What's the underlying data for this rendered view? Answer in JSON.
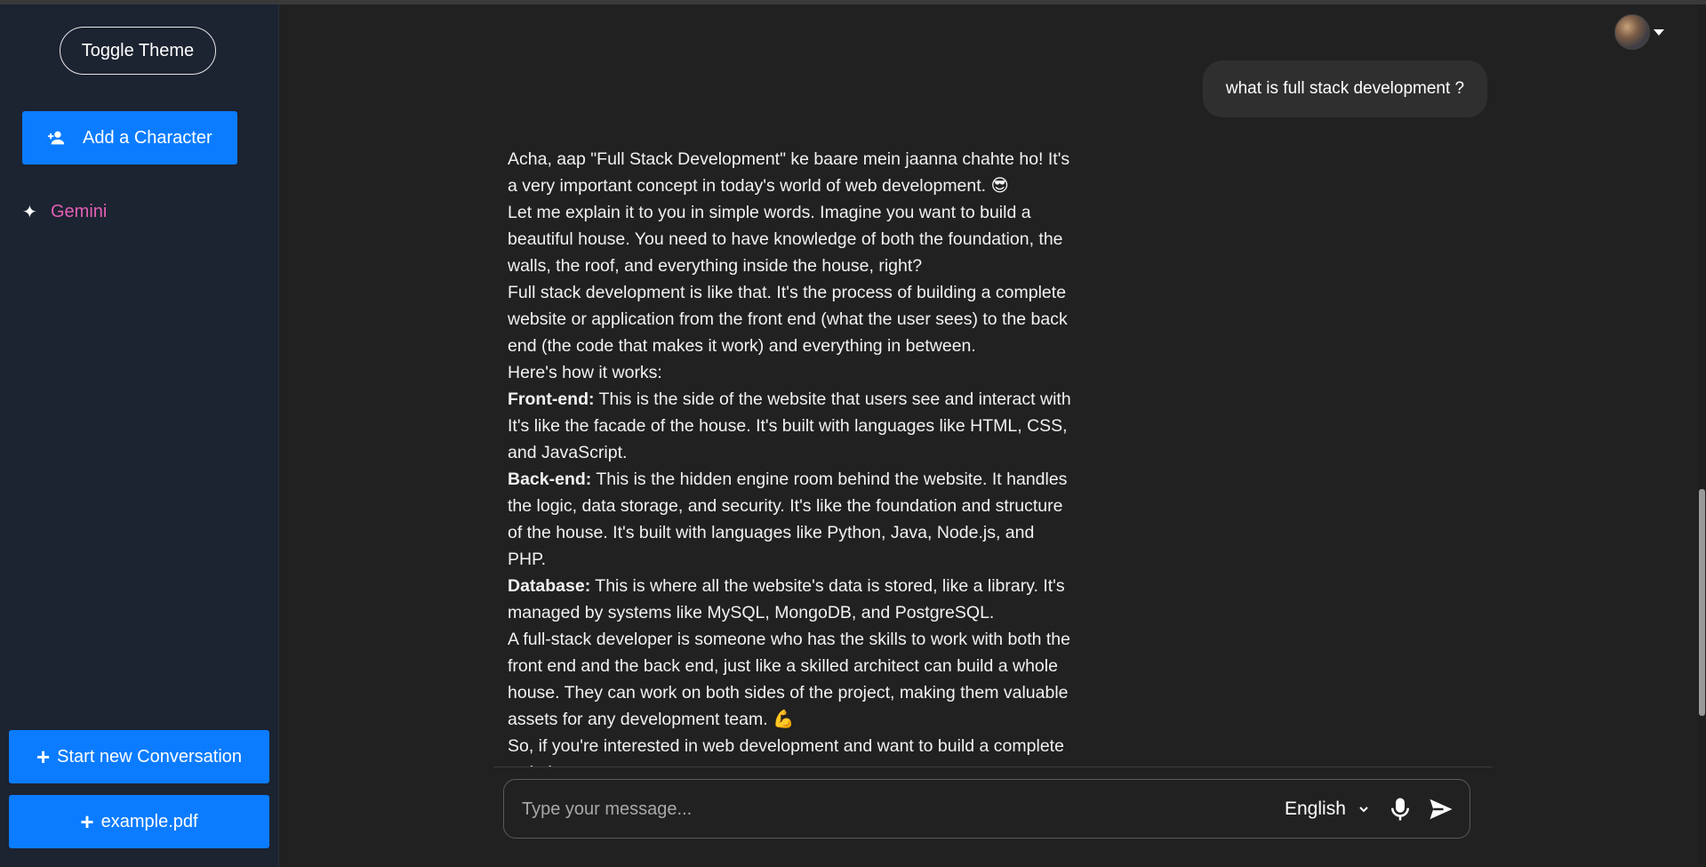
{
  "sidebar": {
    "toggle_theme": "Toggle Theme",
    "add_character": "Add a Character",
    "characters": [
      {
        "label": "Gemini",
        "icon": "sparkle-icon"
      }
    ],
    "start_new_conversation": "Start new Conversation",
    "upload_file": "example.pdf"
  },
  "chat": {
    "user_message": "what is full stack development ?",
    "bot_paragraphs": [
      {
        "bold": "",
        "text": "Acha, aap \"Full Stack Development\" ke baare mein jaanna chahte ho! It's a very important concept in today's world of web development. 😎"
      },
      {
        "bold": "",
        "text": "Let me explain it to you in simple words. Imagine you want to build a beautiful house. You need to have knowledge of both the foundation, the walls, the roof, and everything inside the house, right?"
      },
      {
        "bold": "",
        "text": "Full stack development is like that. It's the process of building a complete website or application from the front end (what the user sees) to the back end (the code that makes it work) and everything in between."
      },
      {
        "bold": "",
        "text": "Here's how it works:"
      },
      {
        "bold": "Front-end:",
        "text": " This is the side of the website that users see and interact with. It's like the facade of the house. It's built with languages like HTML, CSS, and JavaScript."
      },
      {
        "bold": "Back-end:",
        "text": " This is the hidden engine room behind the website. It handles the logic, data storage, and security. It's like the foundation and structure of the house. It's built with languages like Python, Java, Node.js, and PHP."
      },
      {
        "bold": "Database:",
        "text": " This is where all the website's data is stored, like a library. It's managed by systems like MySQL, MongoDB, and PostgreSQL."
      },
      {
        "bold": "",
        "text": "A full-stack developer is someone who has the skills to work with both the front end and the back end, just like a skilled architect can build a whole house. They can work on both sides of the project, making them valuable assets for any development team. 💪"
      },
      {
        "bold": "",
        "text": "So, if you're interested in web development and want to build a complete website,"
      }
    ]
  },
  "composer": {
    "placeholder": "Type your message...",
    "language": "English",
    "mic_icon": "microphone-icon",
    "send_icon": "send-icon"
  },
  "header": {
    "avatar_icon": "user-avatar",
    "menu_icon": "caret-down-icon"
  },
  "colors": {
    "accent": "#0b7cff",
    "character_name": "#e45fb5",
    "background": "#212121",
    "sidebar": "#1c2331"
  }
}
